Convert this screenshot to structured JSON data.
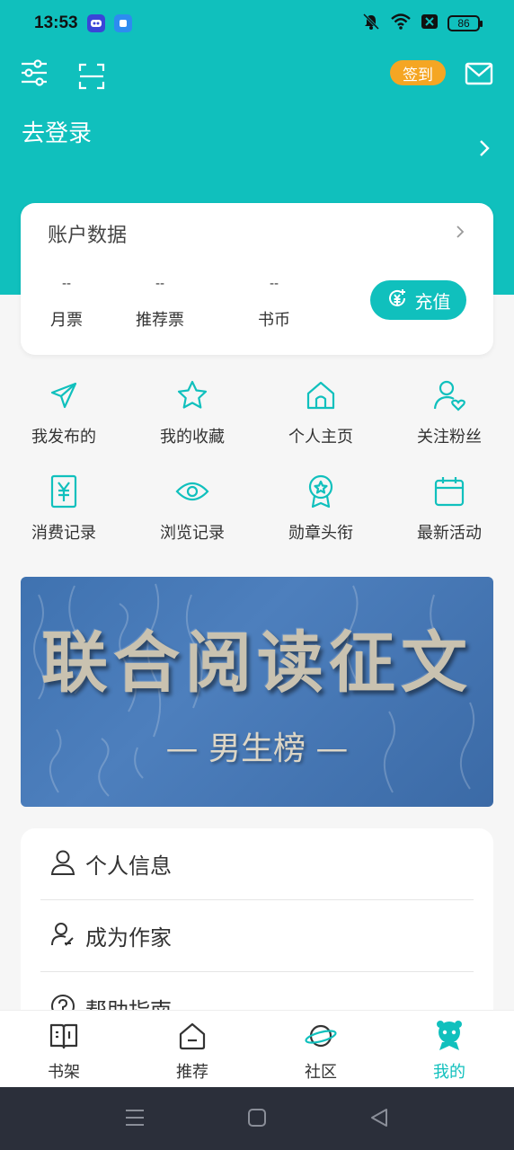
{
  "status_bar": {
    "time": "13:53",
    "battery": "86"
  },
  "header": {
    "signin_label": "签到",
    "login_text": "去登录"
  },
  "account": {
    "title": "账户数据",
    "stats": [
      {
        "value": "--",
        "label": "月票"
      },
      {
        "value": "--",
        "label": "推荐票"
      },
      {
        "value": "--",
        "label": "书币"
      }
    ],
    "recharge_label": "充值"
  },
  "grid": [
    {
      "label": "我发布的",
      "icon": "paper-plane-icon"
    },
    {
      "label": "我的收藏",
      "icon": "star-icon"
    },
    {
      "label": "个人主页",
      "icon": "home-icon"
    },
    {
      "label": "关注粉丝",
      "icon": "user-heart-icon"
    },
    {
      "label": "消费记录",
      "icon": "yen-receipt-icon"
    },
    {
      "label": "浏览记录",
      "icon": "eye-icon"
    },
    {
      "label": "勋章头衔",
      "icon": "medal-icon"
    },
    {
      "label": "最新活动",
      "icon": "calendar-icon"
    }
  ],
  "banner": {
    "title": "联合阅读征文",
    "subtitle": "— 男生榜 —"
  },
  "menu": [
    {
      "label": "个人信息",
      "icon": "user-icon"
    },
    {
      "label": "成为作家",
      "icon": "writer-icon"
    },
    {
      "label": "帮助指南",
      "icon": "help-icon"
    }
  ],
  "bottom_nav": [
    {
      "label": "书架",
      "icon": "bookshelf-icon"
    },
    {
      "label": "推荐",
      "icon": "recommend-icon"
    },
    {
      "label": "社区",
      "icon": "planet-icon"
    },
    {
      "label": "我的",
      "icon": "mascot-icon"
    }
  ],
  "colors": {
    "accent": "#10c0bd",
    "signin": "#f5a623",
    "banner": "#3f72b0"
  }
}
